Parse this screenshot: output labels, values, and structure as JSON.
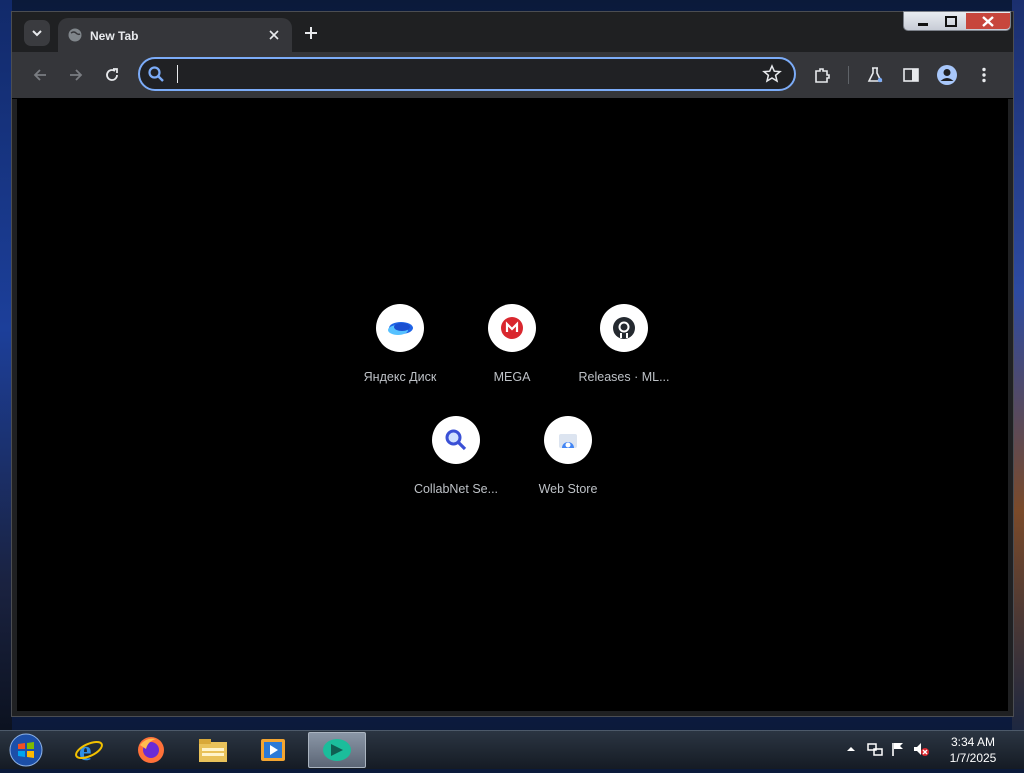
{
  "browser": {
    "tab": {
      "title": "New Tab",
      "close_label": "×"
    },
    "new_tab_label": "+",
    "omnibox": {
      "value": "",
      "placeholder": ""
    }
  },
  "shortcuts": [
    {
      "label": "Яндекс Диск",
      "icon": "yandex-disk-icon"
    },
    {
      "label": "MEGA",
      "icon": "mega-icon"
    },
    {
      "label": "Releases · ML...",
      "icon": "github-icon"
    },
    {
      "label": "CollabNet Se...",
      "icon": "magnifier-icon"
    },
    {
      "label": "Web Store",
      "icon": "web-store-icon"
    }
  ],
  "taskbar": {
    "apps": [
      "internet-explorer-icon",
      "firefox-icon",
      "file-explorer-icon",
      "media-player-icon",
      "active-app-icon"
    ],
    "clock": {
      "time": "3:34 AM",
      "date": "1/7/2025"
    }
  },
  "colors": {
    "accent": "#7cacf8",
    "page_bg": "#000000",
    "toolbar": "#35363a"
  }
}
